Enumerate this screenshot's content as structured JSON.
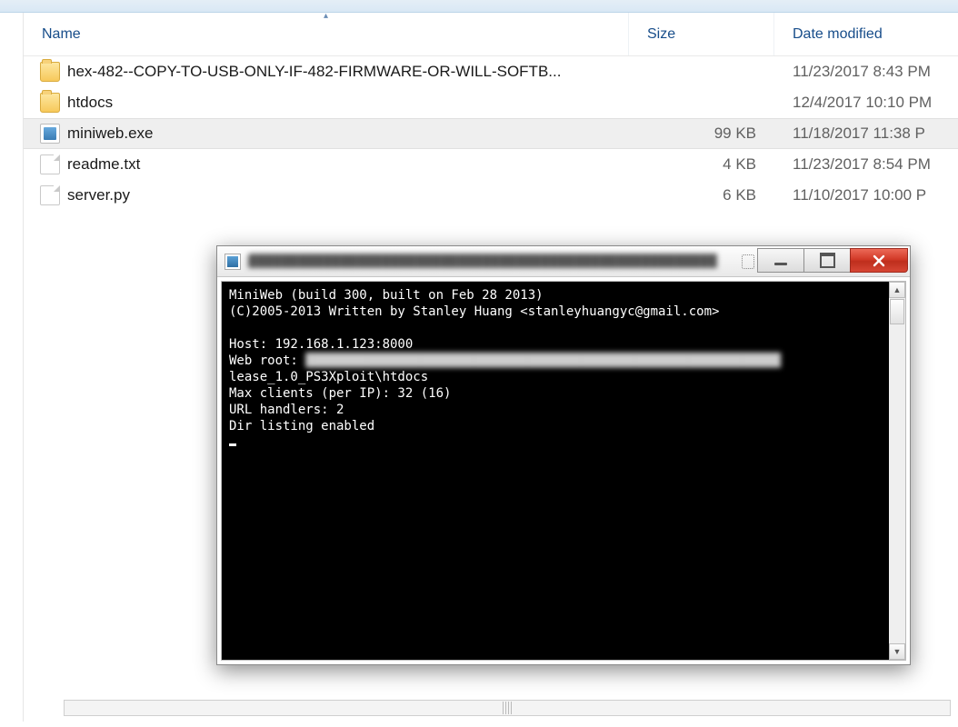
{
  "columns": {
    "name": "Name",
    "size": "Size",
    "date": "Date modified"
  },
  "files": [
    {
      "type": "folder",
      "name": "hex-482--COPY-TO-USB-ONLY-IF-482-FIRMWARE-OR-WILL-SOFTB...",
      "size": "",
      "date": "11/23/2017 8:43 PM",
      "selected": false
    },
    {
      "type": "folder",
      "name": "htdocs",
      "size": "",
      "date": "12/4/2017 10:10 PM",
      "selected": false
    },
    {
      "type": "exe",
      "name": "miniweb.exe",
      "size": "99 KB",
      "date": "11/18/2017 11:38 P",
      "selected": true
    },
    {
      "type": "file",
      "name": "readme.txt",
      "size": "4 KB",
      "date": "11/23/2017 8:54 PM",
      "selected": false
    },
    {
      "type": "file",
      "name": "server.py",
      "size": "6 KB",
      "date": "11/10/2017 10:00 P",
      "selected": false
    }
  ],
  "console": {
    "lines": {
      "l1": "MiniWeb (build 300, built on Feb 28 2013)",
      "l2": "(C)2005-2013 Written by Stanley Huang <stanleyhuangyc@gmail.com>",
      "l3": "",
      "l4": "Host: 192.168.1.123:8000",
      "l5a": "Web root: ",
      "l6": "lease_1.0_PS3Xploit\\htdocs",
      "l7": "Max clients (per IP): 32 (16)",
      "l8": "URL handlers: 2",
      "l9": "Dir listing enabled"
    }
  }
}
